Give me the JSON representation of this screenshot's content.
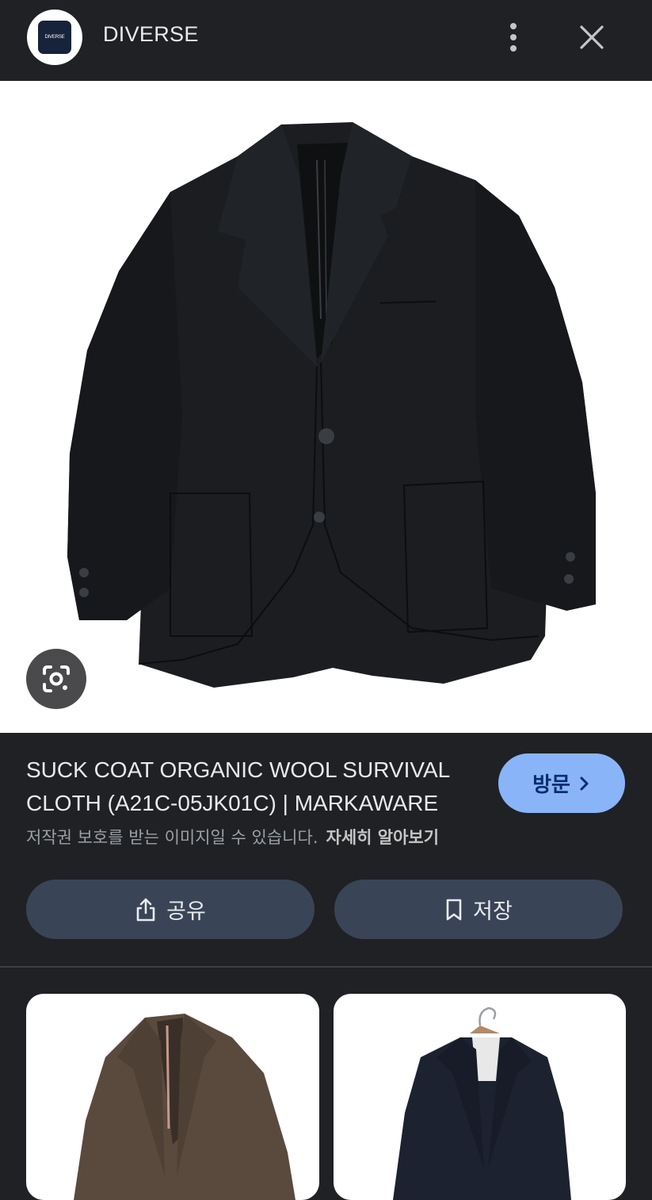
{
  "header": {
    "logo_text": "DIVERSE",
    "site_name": "DIVERSE",
    "more_icon": "more-vert-icon",
    "close_icon": "close-icon"
  },
  "image": {
    "alt": "Black wool jacket",
    "lens_icon": "google-lens-icon"
  },
  "result": {
    "title": "SUCK COAT ORGANIC WOOL SURVIVAL CLOTH (A21C-05JK01C) | MARKAWARE",
    "visit_label": "방문",
    "copyright_notice": "저작권 보호를 받는 이미지일 수 있습니다.",
    "learn_more": "자세히 알아보기"
  },
  "actions": {
    "share_label": "공유",
    "save_label": "저장"
  },
  "related": [
    {
      "alt": "Brown wool jacket"
    },
    {
      "alt": "Navy jacket on hanger"
    }
  ],
  "colors": {
    "background": "#202124",
    "accent": "#8ab4f8",
    "button_bg": "#394457"
  }
}
